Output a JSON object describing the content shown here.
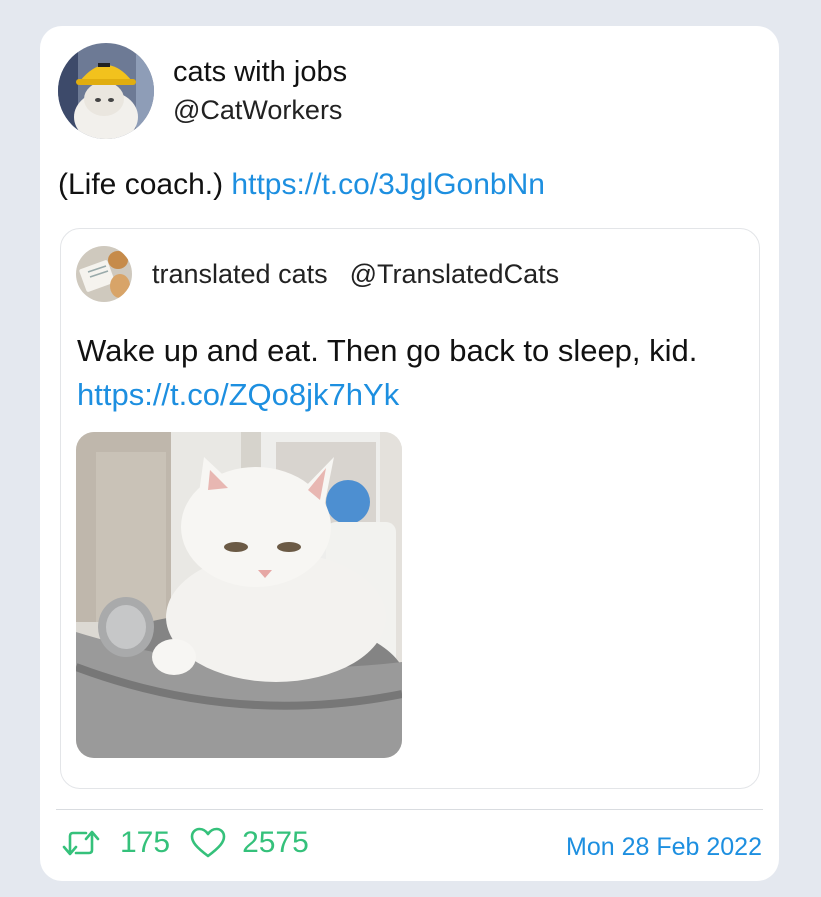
{
  "tweet": {
    "author_name": "cats with jobs",
    "author_handle": "@CatWorkers",
    "text": "(Life coach.)",
    "link": "https://t.co/3JglGonbNn"
  },
  "quoted_tweet": {
    "author_name": "translated cats",
    "author_handle": "@TranslatedCats",
    "text": "Wake up and eat. Then go back to sleep, kid.",
    "link": "https://t.co/ZQo8jk7hYk"
  },
  "stats": {
    "retweets": "175",
    "likes": "2575",
    "date": "Mon 28 Feb 2022"
  },
  "icons": {
    "retweet": "retweet-icon",
    "like": "heart-icon"
  },
  "colors": {
    "link": "#1d8fe0",
    "stats_green": "#35c17b",
    "page_background": "#e4e8ef",
    "card_background": "#ffffff"
  }
}
